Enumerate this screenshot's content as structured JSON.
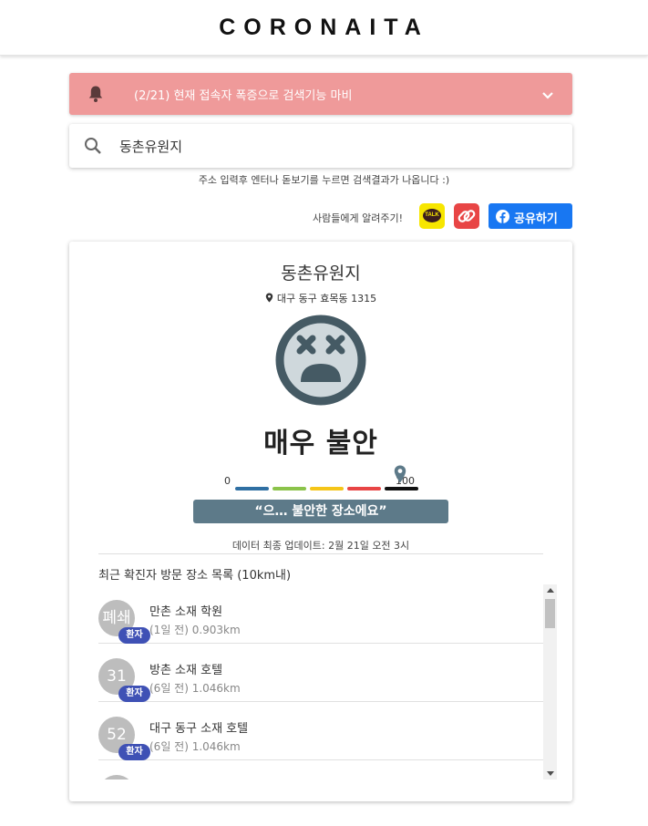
{
  "header": {
    "logo": "CORONAITA"
  },
  "notice": {
    "text": "(2/21) 현재 접속자 폭증으로 검색기능 마비",
    "bg_color": "#ef9a9a"
  },
  "search": {
    "value": "동촌유원지",
    "hint": "주소 입력후 엔터나 돋보기를 누르면 검색결과가 나옵니다 :)"
  },
  "share": {
    "label": "사람들에게 알려주기!",
    "kakao_text": "TALK",
    "facebook_label": "공유하기"
  },
  "place": {
    "name": "동촌유원지",
    "address": "대구 동구 효목동 1315",
    "status": "매우 불안",
    "gauge_min": "0",
    "gauge_max": "100",
    "gauge_level_percent": 90,
    "message": "“으… 불안한 장소에요”",
    "updated": "데이터 최종 업데이트: 2월 21일 오전 3시"
  },
  "visits": {
    "title": "최근 확진자 방문 장소 목록 (10km내)",
    "items": [
      {
        "avatar": "폐쇄",
        "badge": "환자",
        "title": "만촌 소재 학원",
        "subtitle": "(1일 전) 0.903km"
      },
      {
        "avatar": "31",
        "badge": "환자",
        "title": "방촌 소재 호텔",
        "subtitle": "(6일 전) 1.046km"
      },
      {
        "avatar": "52",
        "badge": "환자",
        "title": "대구 동구 소재 호텔",
        "subtitle": "(6일 전) 1.046km"
      }
    ]
  },
  "colors": {
    "gauge_segments": [
      "#2f6fa3",
      "#8bc34a",
      "#f5c518",
      "#e84545",
      "#111111"
    ],
    "badge": "#3f51b5",
    "message_bg": "#5d7a89",
    "facebook": "#1877f2",
    "kakao": "#f7e600"
  },
  "icons": {
    "notice": "bell-icon",
    "expand": "chevron-down-icon",
    "search": "search-icon",
    "address": "location-pin-icon",
    "mood": "dizzy-face-icon",
    "link": "link-icon",
    "facebook": "facebook-icon"
  }
}
